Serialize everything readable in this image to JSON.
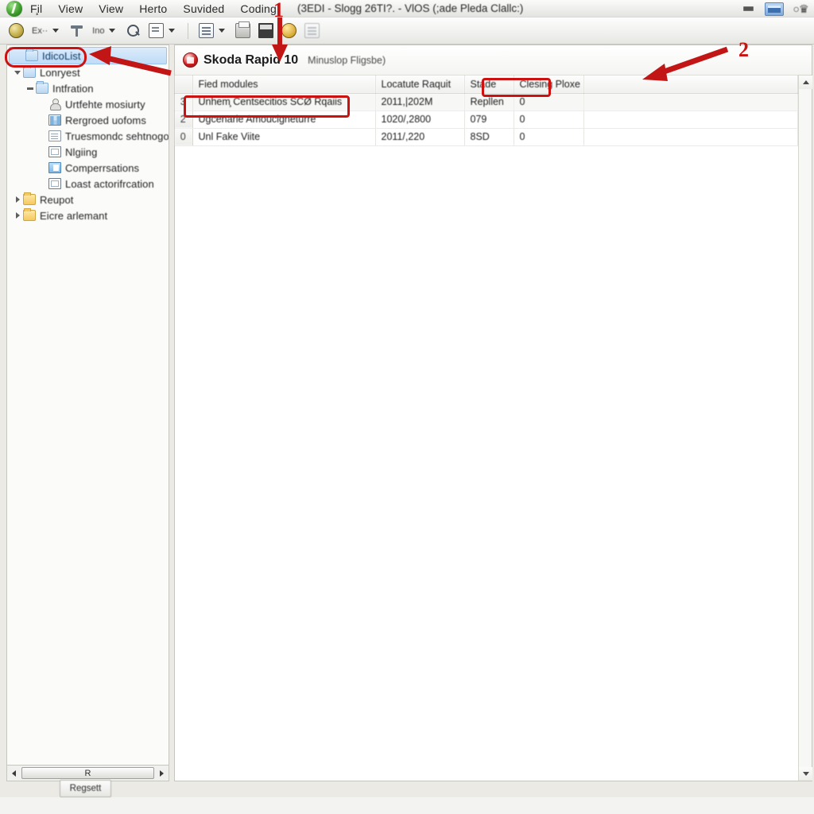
{
  "window": {
    "title": "(3EDI - Slogg 26TI?. - VlOS (;ade  Pleda  Clallc:)",
    "logo_icon": "app-logo-green",
    "controls": {
      "minimize_icon": "minimize-icon",
      "maximize_icon": "maximize-icon",
      "close_icon": "close-icon"
    }
  },
  "menubar": {
    "items": [
      {
        "label": "F̧il"
      },
      {
        "label": "View"
      },
      {
        "label": "View"
      },
      {
        "label": "Herto"
      },
      {
        "label": "Suvided"
      },
      {
        "label": "Coding"
      }
    ]
  },
  "toolbar": {
    "items": [
      {
        "label": "",
        "icon": "globe-icon",
        "has_caret": false
      },
      {
        "label": "Ex··",
        "icon": "",
        "has_caret": true
      },
      {
        "label": "",
        "icon": "funnel-icon",
        "has_caret": false
      },
      {
        "label": "Ino",
        "icon": "",
        "has_caret": true
      },
      {
        "label": "",
        "icon": "search-icon",
        "has_caret": false
      },
      {
        "label": "",
        "icon": "box-icon",
        "has_caret": true
      },
      {
        "label": "",
        "icon": "list-icon",
        "has_caret": true
      },
      {
        "label": "",
        "icon": "print-icon",
        "has_caret": false
      },
      {
        "label": "",
        "icon": "grid-icon",
        "has_caret": false
      },
      {
        "label": "",
        "icon": "coin-icon",
        "has_caret": false
      }
    ]
  },
  "sidebar": {
    "items": [
      {
        "label": "IdicoList",
        "icon": "folder-blue-icon",
        "indent": 1,
        "expander": "none",
        "selected": true
      },
      {
        "label": "Lonryest",
        "icon": "folder-blue-icon",
        "indent": 1,
        "expander": "chev-down",
        "selected": false
      },
      {
        "label": "Intfration",
        "icon": "folder-blue-icon",
        "indent": 2,
        "expander": "minus",
        "selected": false
      },
      {
        "label": "Urtfehte mosiurty",
        "icon": "person-icon",
        "indent": 3,
        "expander": "none",
        "selected": false
      },
      {
        "label": "Rergroed uofoms",
        "icon": "grid-icon",
        "indent": 3,
        "expander": "none",
        "selected": false
      },
      {
        "label": "Truesmondc sehtnogor",
        "icon": "doc-icon",
        "indent": 3,
        "expander": "none",
        "selected": false
      },
      {
        "label": "Nlgiing",
        "icon": "window-icon",
        "indent": 3,
        "expander": "none",
        "selected": false
      },
      {
        "label": "Comperrsations",
        "icon": "window-blue-icon",
        "indent": 3,
        "expander": "none",
        "selected": false
      },
      {
        "label": "Loast actorifrcation",
        "icon": "window-icon",
        "indent": 3,
        "expander": "none",
        "selected": false
      },
      {
        "label": "Reupot",
        "icon": "folder-icon",
        "indent": 1,
        "expander": "chev-right",
        "selected": false
      },
      {
        "label": "Eiсre arlemant",
        "icon": "folder-icon",
        "indent": 1,
        "expander": "chev-right",
        "selected": false
      }
    ],
    "hscroll": {
      "left_arrow_icon": "scroll-left-icon",
      "thumb_label": "R",
      "right_arrow_icon": "scroll-right-icon"
    },
    "bottom_button": {
      "label": "Regsett"
    }
  },
  "panel": {
    "badge_icon": "skoda-badge-icon",
    "title": "Skoda Rapid 10",
    "subtitle": "Minuslop Fligsbe)",
    "vscroll": {
      "up_arrow_icon": "scroll-up-icon",
      "down_arrow_icon": "scroll-down-icon"
    }
  },
  "table": {
    "columns": [
      {
        "key": "num",
        "label": ""
      },
      {
        "key": "name",
        "label": "Fied modules"
      },
      {
        "key": "date",
        "label": "Locatute Raquit"
      },
      {
        "key": "state",
        "label": "Stade"
      },
      {
        "key": "price",
        "label": "Clesing Ploxe"
      },
      {
        "key": "rest",
        "label": ""
      }
    ],
    "rows": [
      {
        "num": "3",
        "name": "Unhem̧ Centsecitios SCØ Rqaiis",
        "date": "2011,|202M",
        "state": "Repllen",
        "price": "0",
        "rest": ""
      },
      {
        "num": "2",
        "name": "Ugcenarle Amoucigneturre",
        "date": "1020/,2800",
        "state": "079",
        "price": "0",
        "rest": ""
      },
      {
        "num": "0",
        "name": "Unl Fake Viite",
        "date": "2011/,220",
        "state": "8SD",
        "price": "0",
        "rest": ""
      }
    ]
  },
  "annotations": [
    {
      "id": "1",
      "number": "1",
      "kind": "arrow-down",
      "target": "toolbar-to-panel-header"
    },
    {
      "id": "2",
      "number": "2",
      "kind": "arrow-left",
      "target": "table-header-row"
    },
    {
      "id": "3",
      "number": "",
      "kind": "rect",
      "target": "sidebar-selected-item"
    },
    {
      "id": "4",
      "number": "",
      "kind": "arrow-left",
      "target": "sidebar-selected-item"
    },
    {
      "id": "5",
      "number": "",
      "kind": "rect",
      "target": "first-table-row-name"
    },
    {
      "id": "6",
      "number": "",
      "kind": "rect",
      "target": "closing-price-column-header"
    }
  ],
  "colors": {
    "annotation_red": "#cc1111",
    "selection_blue": "#bfdcf7",
    "window_chrome": "#f0f0ee",
    "panel_background": "#ffffff"
  }
}
